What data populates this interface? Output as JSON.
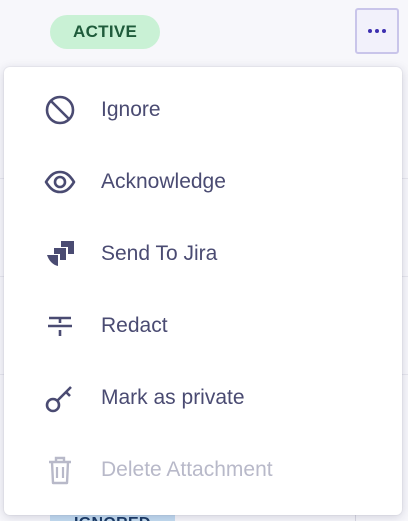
{
  "row": {
    "status_badge": "ACTIVE",
    "bottom_badge": "IGNORED"
  },
  "menu": {
    "items": [
      {
        "label": "Ignore",
        "icon": "ban-icon",
        "enabled": true
      },
      {
        "label": "Acknowledge",
        "icon": "eye-icon",
        "enabled": true
      },
      {
        "label": "Send To Jira",
        "icon": "jira-icon",
        "enabled": true
      },
      {
        "label": "Redact",
        "icon": "strikethrough-icon",
        "enabled": true
      },
      {
        "label": "Mark as private",
        "icon": "key-icon",
        "enabled": true
      },
      {
        "label": "Delete Attachment",
        "icon": "trash-icon",
        "enabled": false
      }
    ]
  },
  "colors": {
    "menu_text": "#4a4b72",
    "disabled_text": "#b8b9c9",
    "status_badge_bg": "#c9f1d5",
    "status_badge_text": "#1f5b3b",
    "more_button_dots": "#3d2fb0"
  }
}
